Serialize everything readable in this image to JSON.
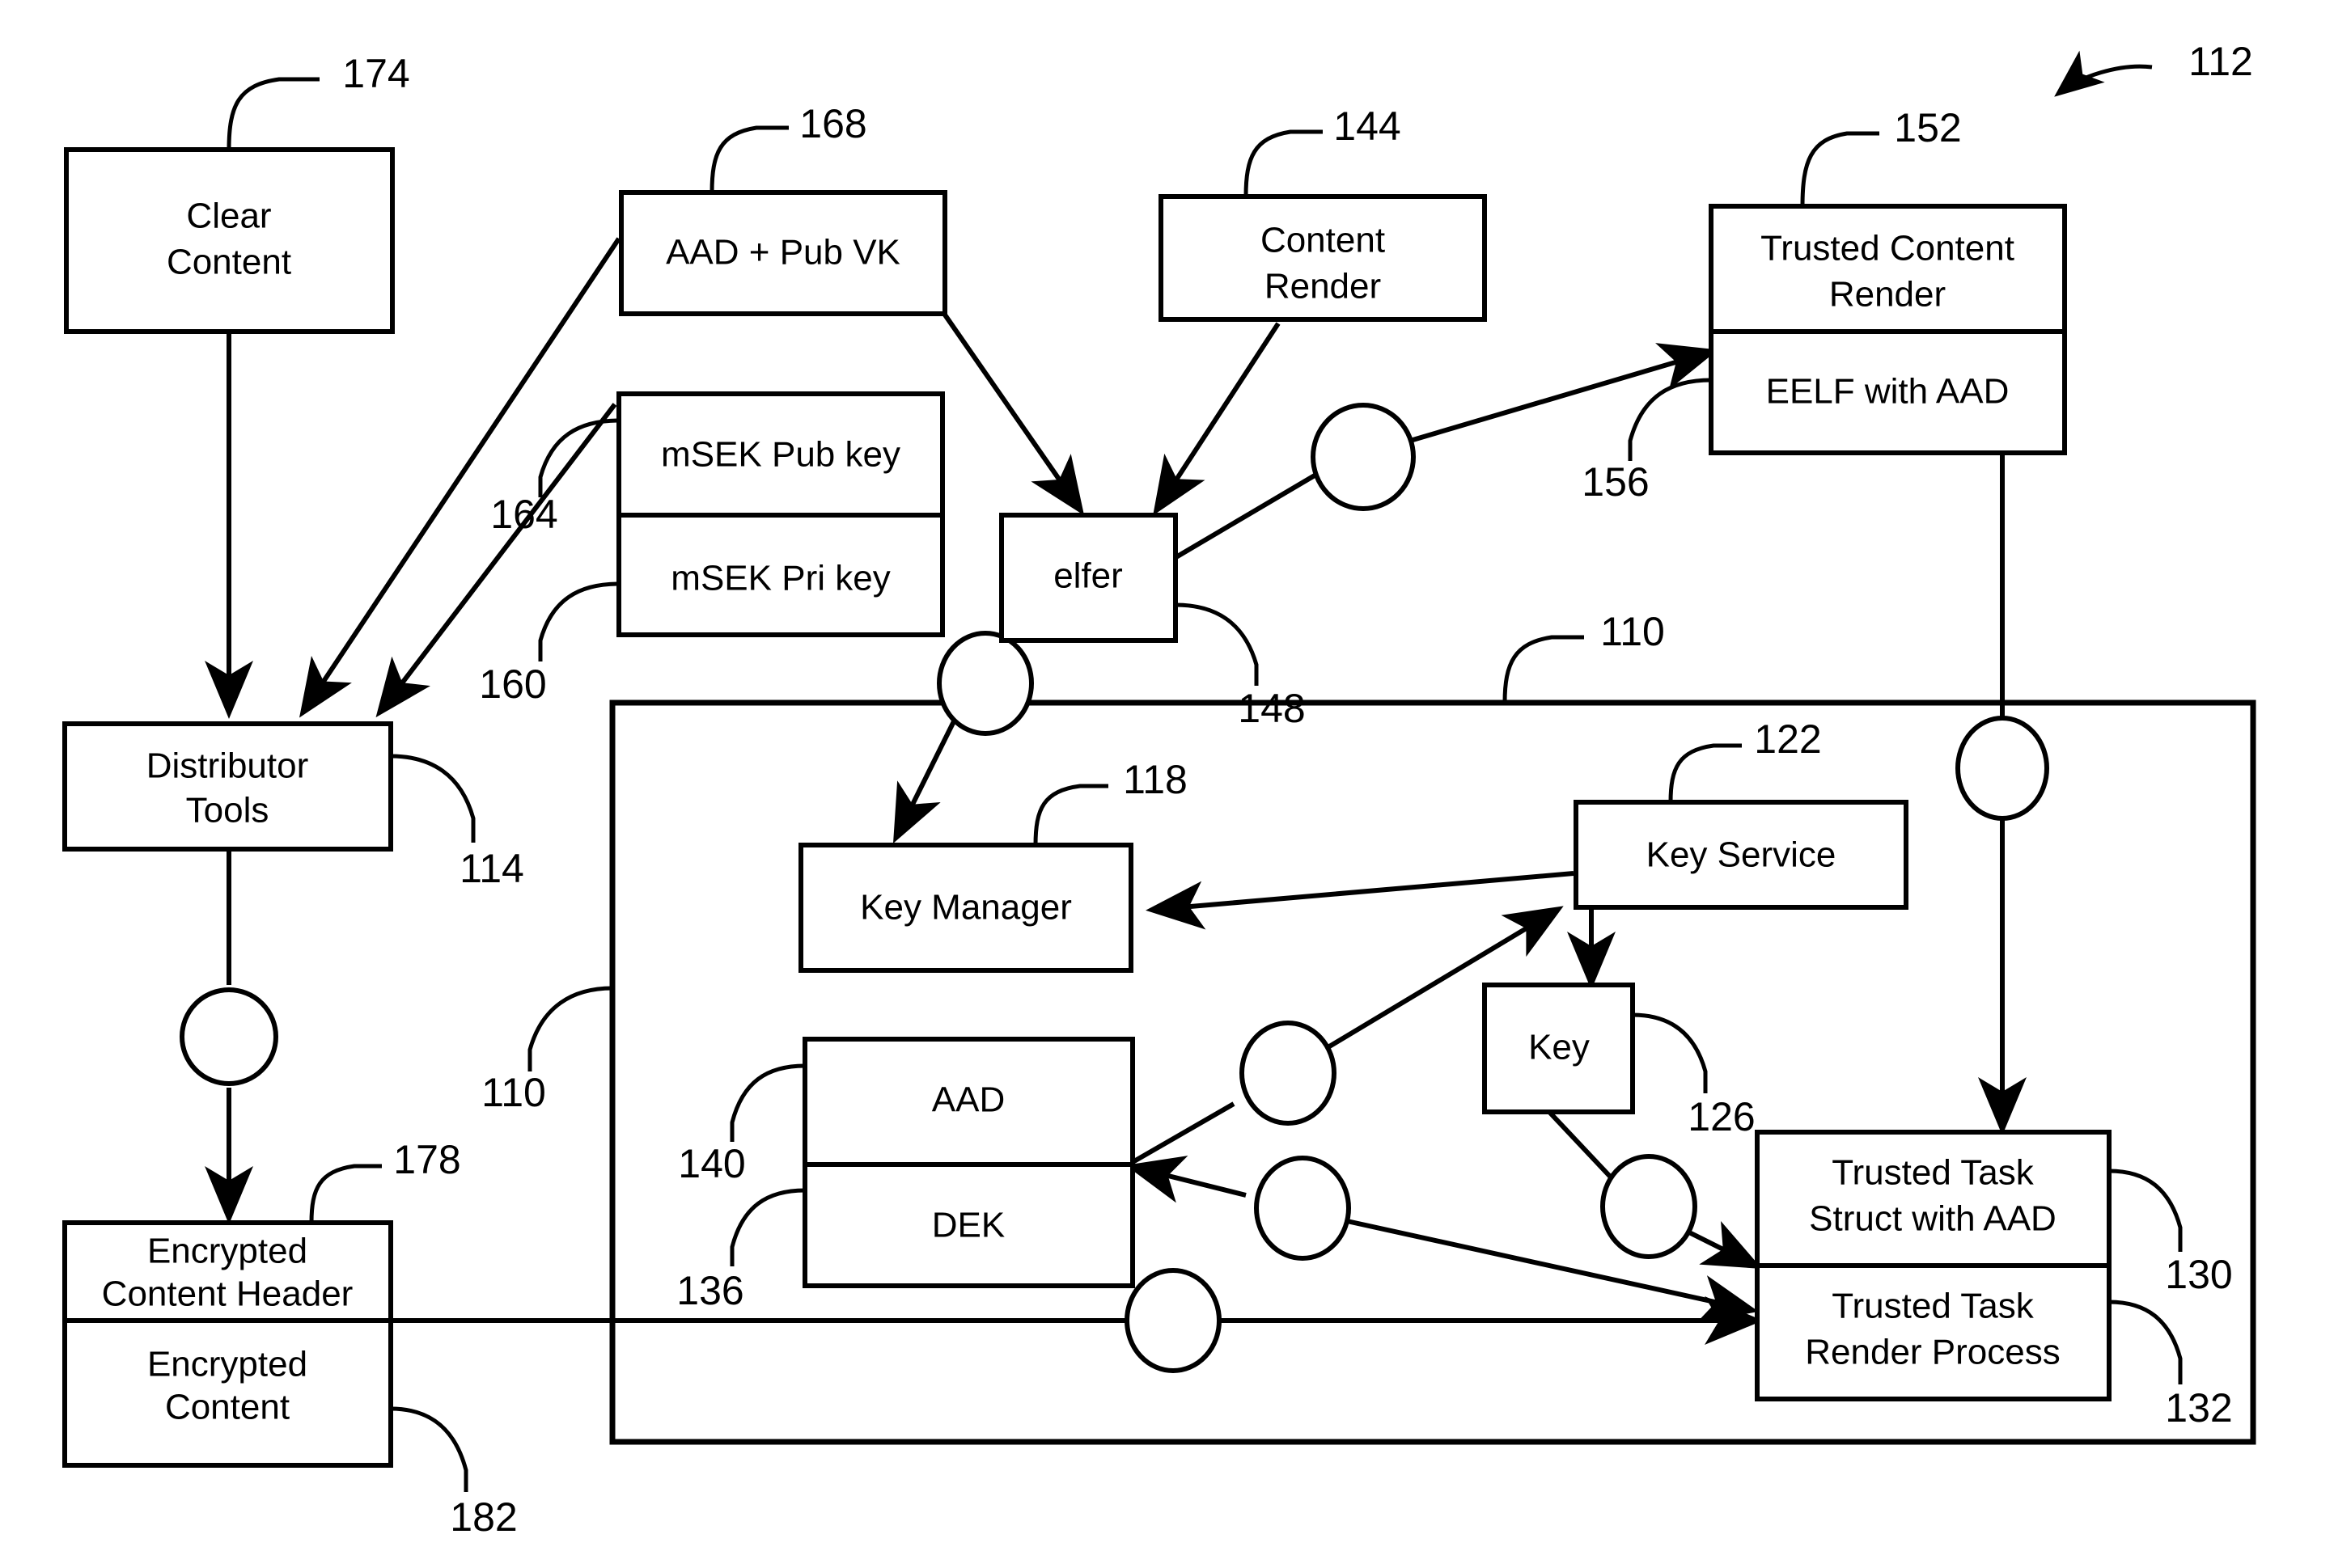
{
  "figure": {
    "type": "patent-block-diagram",
    "overall_reference": "112"
  },
  "boxes": {
    "clear_content": {
      "label_line1": "Clear",
      "label_line2": "Content",
      "ref": "174"
    },
    "aad_pub_vk": {
      "label": "AAD + Pub VK",
      "ref": "168"
    },
    "content_render": {
      "label_line1": "Content",
      "label_line2": "Render",
      "ref": "144"
    },
    "trusted_content_render": {
      "label_line1": "Trusted Content",
      "label_line2": "Render",
      "ref": "152"
    },
    "eelf_with_aad": {
      "label": "EELF with AAD",
      "ref": "156"
    },
    "msek_pub_key": {
      "label": "mSEK Pub key",
      "ref": "164"
    },
    "msek_pri_key": {
      "label": "mSEK Pri key",
      "ref": "160"
    },
    "elfer": {
      "label": "elfer",
      "ref": "148"
    },
    "distributor_tools": {
      "label_line1": "Distributor",
      "label_line2": "Tools",
      "ref": "114"
    },
    "encrypted_content_header": {
      "label_line1": "Encrypted",
      "label_line2": "Content Header",
      "ref": "178"
    },
    "encrypted_content": {
      "label_line1": "Encrypted",
      "label_line2": "Content",
      "ref": "182"
    },
    "key_manager": {
      "label": "Key Manager",
      "ref": "118"
    },
    "key_service": {
      "label": "Key Service",
      "ref": "122"
    },
    "key": {
      "label": "Key",
      "ref": "126"
    },
    "aad": {
      "label": "AAD",
      "ref": "140"
    },
    "dek": {
      "label": "DEK",
      "ref": "136"
    },
    "trusted_task_struct": {
      "label_line1": "Trusted Task",
      "label_line2": "Struct with AAD",
      "ref": "130"
    },
    "trusted_task_render": {
      "label_line1": "Trusted Task",
      "label_line2": "Render Process",
      "ref": "132"
    },
    "platform_container": {
      "ref_left": "110",
      "ref_top": "110"
    }
  },
  "reference_numerals": [
    "174",
    "168",
    "144",
    "152",
    "112",
    "156",
    "164",
    "160",
    "148",
    "110",
    "118",
    "122",
    "126",
    "114",
    "140",
    "136",
    "178",
    "182",
    "130",
    "132"
  ],
  "colors": {
    "ink": "#000000",
    "paper": "#ffffff"
  }
}
